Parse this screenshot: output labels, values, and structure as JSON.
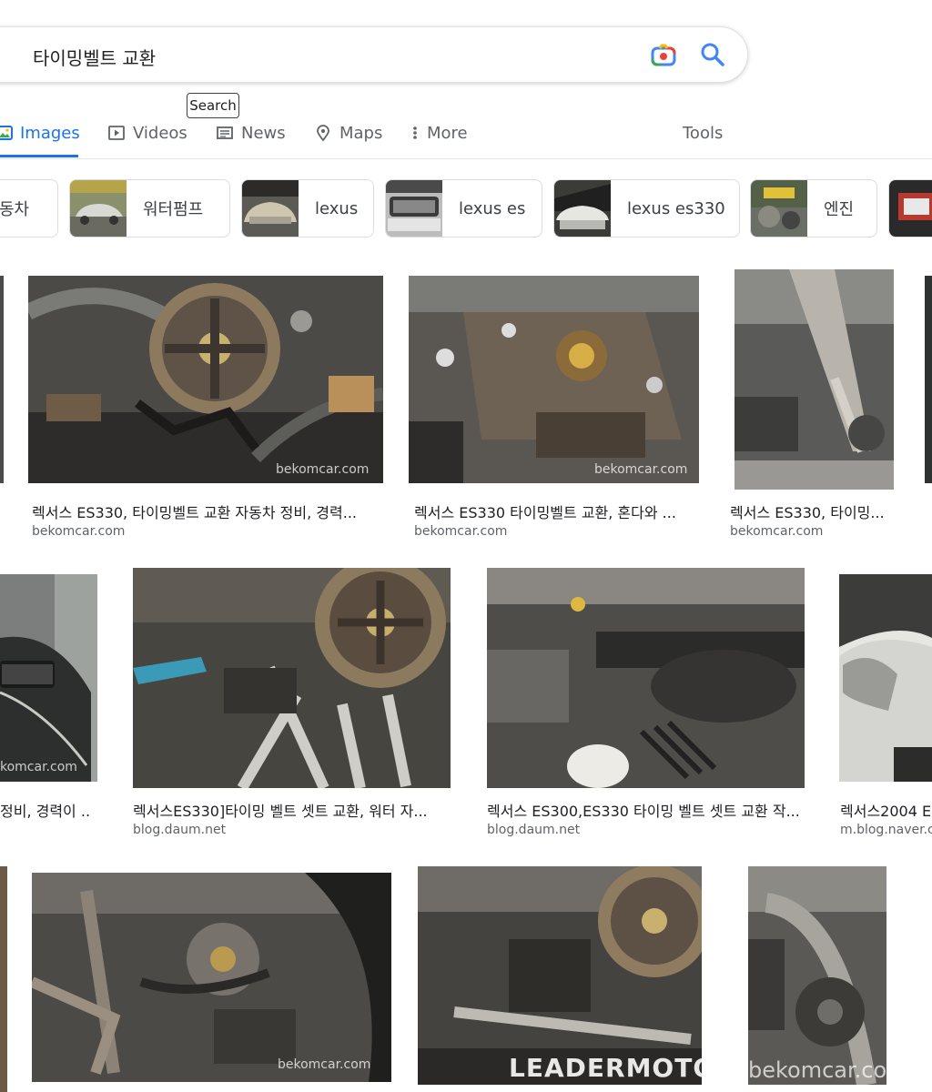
{
  "search": {
    "query": "타이밍벨트 교환",
    "tooltip": "Search",
    "camera_icon": "google-lens-icon",
    "search_icon": "magnifier-icon"
  },
  "tabs": [
    {
      "label": "Images",
      "icon": "image-icon",
      "active": true
    },
    {
      "label": "Videos",
      "icon": "play-icon",
      "active": false
    },
    {
      "label": "News",
      "icon": "newspaper-icon",
      "active": false
    },
    {
      "label": "Maps",
      "icon": "map-pin-icon",
      "active": false
    },
    {
      "label": "More",
      "icon": "more-vert-icon",
      "active": false
    }
  ],
  "tools_label": "Tools",
  "chips": [
    {
      "label": "동차"
    },
    {
      "label": "워터펌프"
    },
    {
      "label": "lexus"
    },
    {
      "label": "lexus es"
    },
    {
      "label": "lexus es330"
    },
    {
      "label": "엔진"
    }
  ],
  "results": [
    {
      "caption": "렉서스 ES330, 타이밍벨트 교환 자동차 정비, 경력...",
      "source": "bekomcar.com",
      "watermark": "bekomcar.com"
    },
    {
      "caption": "렉서스 ES330 타이밍벨트 교환, 혼다와 ...",
      "source": "bekomcar.com",
      "watermark": "bekomcar.com"
    },
    {
      "caption": "렉서스 ES330, 타이밍...",
      "source": "bekomcar.com",
      "watermark": ""
    },
    {
      "caption": "정비, 경력이 ...",
      "source": "",
      "watermark": "komcar.com"
    },
    {
      "caption": "렉서스ES330]타이밍 벨트 셋트 교환, 워터 자...",
      "source": "blog.daum.net",
      "watermark": ""
    },
    {
      "caption": "렉서스 ES300,ES330 타이밍 벨트 셋트 교환 작...",
      "source": "blog.daum.net",
      "watermark": ""
    },
    {
      "caption": "렉서스2004 E",
      "source": "m.blog.naver.c",
      "watermark": ""
    },
    {
      "caption": "",
      "source": "",
      "watermark": "bekomcar.com"
    },
    {
      "caption": "",
      "source": "",
      "watermark": "LEADERMOTORS"
    },
    {
      "caption": "",
      "source": "",
      "watermark": "bekomcar.com"
    }
  ],
  "colors": {
    "accent": "#1a73e8",
    "text": "#202124",
    "secondary": "#5f6368",
    "border": "#dadce0"
  }
}
